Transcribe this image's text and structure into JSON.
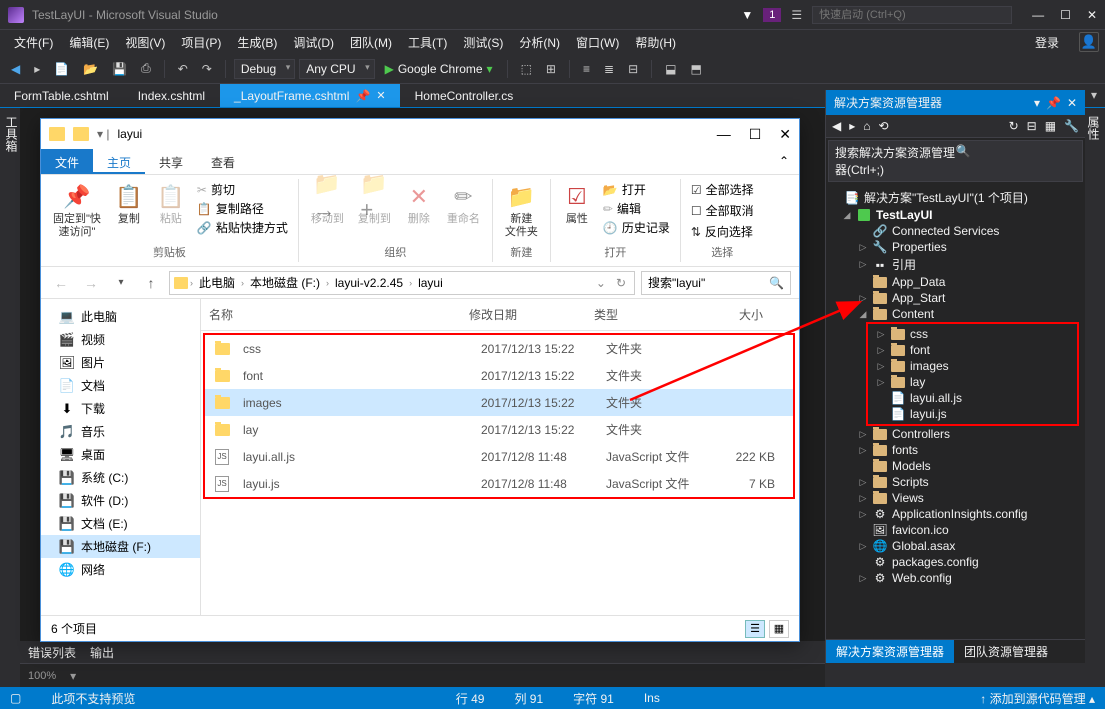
{
  "title": "TestLayUI - Microsoft Visual Studio",
  "flag_badge": "1",
  "quick_launch_placeholder": "快速启动 (Ctrl+Q)",
  "menus": [
    "文件(F)",
    "编辑(E)",
    "视图(V)",
    "项目(P)",
    "生成(B)",
    "调试(D)",
    "团队(M)",
    "工具(T)",
    "测试(S)",
    "分析(N)",
    "窗口(W)",
    "帮助(H)"
  ],
  "login": "登录",
  "toolbar": {
    "config": "Debug",
    "platform": "Any CPU",
    "run": "Google Chrome"
  },
  "tabs": [
    {
      "label": "FormTable.cshtml",
      "active": false
    },
    {
      "label": "Index.cshtml",
      "active": false
    },
    {
      "label": "_LayoutFrame.cshtml",
      "active": true
    },
    {
      "label": "HomeController.cs",
      "active": false
    }
  ],
  "side_left": "工具箱",
  "side_right": "属性",
  "solution": {
    "panel_title": "解决方案资源管理器",
    "search_placeholder": "搜索解决方案资源管理器(Ctrl+;)",
    "root": "解决方案\"TestLayUI\"(1 个项目)",
    "project": "TestLayUI",
    "nodes": {
      "connected": "Connected Services",
      "properties": "Properties",
      "refs": "引用",
      "appdata": "App_Data",
      "appstart": "App_Start",
      "content": "Content",
      "css": "css",
      "font": "font",
      "images": "images",
      "lay": "lay",
      "layuiall": "layui.all.js",
      "layuijs": "layui.js",
      "controllers": "Controllers",
      "fonts": "fonts",
      "models": "Models",
      "scripts": "Scripts",
      "views": "Views",
      "appinsights": "ApplicationInsights.config",
      "favicon": "favicon.ico",
      "global": "Global.asax",
      "packages": "packages.config",
      "webconfig": "Web.config"
    },
    "bottom_tabs": [
      "解决方案资源管理器",
      "团队资源管理器"
    ]
  },
  "output_tabs": [
    "错误列表",
    "输出"
  ],
  "zoom": "100%",
  "status": {
    "preview": "此项不支持预览",
    "line": "行 49",
    "col": "列 91",
    "char": "字符 91",
    "ins": "Ins",
    "git": "添加到源代码管理"
  },
  "explorer": {
    "title": "layui",
    "ribbon_tabs": {
      "file": "文件",
      "home": "主页",
      "share": "共享",
      "view": "查看"
    },
    "ribbon": {
      "pin": "固定到\"快\n速访问\"",
      "copy": "复制",
      "paste": "粘贴",
      "cut": "剪切",
      "copypath": "复制路径",
      "pasteshort": "粘贴快捷方式",
      "clipboard": "剪贴板",
      "moveto": "移动到",
      "copyto": "复制到",
      "delete": "删除",
      "rename": "重命名",
      "organize": "组织",
      "newfolder": "新建\n文件夹",
      "new": "新建",
      "properties": "属性",
      "open": "打开",
      "edit": "编辑",
      "history": "历史记录",
      "open_grp": "打开",
      "selectall": "全部选择",
      "selectnone": "全部取消",
      "invert": "反向选择",
      "select": "选择"
    },
    "breadcrumb": [
      "此电脑",
      "本地磁盘 (F:)",
      "layui-v2.2.45",
      "layui"
    ],
    "search_placeholder": "搜索\"layui\"",
    "nav": [
      {
        "icn": "💻",
        "label": "此电脑"
      },
      {
        "icn": "🎬",
        "label": "视频"
      },
      {
        "icn": "🖼",
        "label": "图片"
      },
      {
        "icn": "📄",
        "label": "文档"
      },
      {
        "icn": "⬇",
        "label": "下载"
      },
      {
        "icn": "🎵",
        "label": "音乐"
      },
      {
        "icn": "🖥",
        "label": "桌面"
      },
      {
        "icn": "💾",
        "label": "系统 (C:)"
      },
      {
        "icn": "💾",
        "label": "软件 (D:)"
      },
      {
        "icn": "💾",
        "label": "文档 (E:)"
      },
      {
        "icn": "💾",
        "label": "本地磁盘 (F:)",
        "sel": true
      },
      {
        "icn": "🌐",
        "label": "网络"
      }
    ],
    "columns": {
      "name": "名称",
      "date": "修改日期",
      "type": "类型",
      "size": "大小"
    },
    "files": [
      {
        "icon": "folder",
        "name": "css",
        "date": "2017/12/13 15:22",
        "type": "文件夹",
        "size": ""
      },
      {
        "icon": "folder",
        "name": "font",
        "date": "2017/12/13 15:22",
        "type": "文件夹",
        "size": ""
      },
      {
        "icon": "folder",
        "name": "images",
        "date": "2017/12/13 15:22",
        "type": "文件夹",
        "size": "",
        "sel": true
      },
      {
        "icon": "folder",
        "name": "lay",
        "date": "2017/12/13 15:22",
        "type": "文件夹",
        "size": ""
      },
      {
        "icon": "js",
        "name": "layui.all.js",
        "date": "2017/12/8 11:48",
        "type": "JavaScript 文件",
        "size": "222 KB"
      },
      {
        "icon": "js",
        "name": "layui.js",
        "date": "2017/12/8 11:48",
        "type": "JavaScript 文件",
        "size": "7 KB"
      }
    ],
    "status": "6 个项目"
  }
}
